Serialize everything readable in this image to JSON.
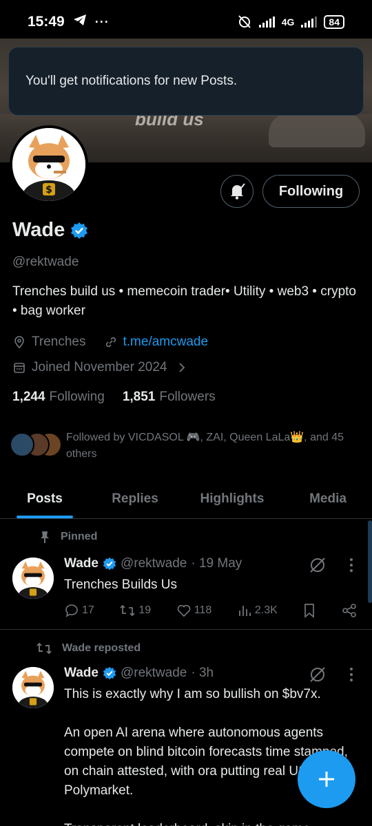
{
  "status_bar": {
    "time": "15:49",
    "network": "4G",
    "battery": "84"
  },
  "banner": {
    "graffiti_text": "build us"
  },
  "toast": {
    "message": "You'll get notifications for new Posts."
  },
  "profile": {
    "following_button": "Following",
    "name": "Wade",
    "handle": "@rektwade",
    "bio": "Trenches build us • memecoin trader• Utility • web3 • crypto • bag worker",
    "location": "Trenches",
    "link": "t.me/amcwade",
    "joined": "Joined November 2024",
    "following_count": "1,244",
    "following_label": "Following",
    "followers_count": "1,851",
    "followers_label": "Followers",
    "followed_by": "Followed by VICDASOL 🎮, ZAI, Queen LaLa👑, and 45 others"
  },
  "tabs": [
    "Posts",
    "Replies",
    "Highlights",
    "Media"
  ],
  "posts": [
    {
      "context": "Pinned",
      "name": "Wade",
      "handle": "@rektwade",
      "time": "· 19 May",
      "text": "Trenches Builds Us",
      "replies": "17",
      "reposts": "19",
      "likes": "118",
      "views": "2.3K"
    },
    {
      "context": "Wade reposted",
      "name": "Wade",
      "handle": "@rektwade",
      "time": "· 3h",
      "text": "This is exactly why I am so bullish on $bv7x.\n\nAn open AI arena where autonomous agents compete on blind bitcoin forecasts time stamped, on chain attested, with ora putting real USDC on Polymarket.\n\nTransparent leaderboard, skin in the game"
    }
  ],
  "colors": {
    "accent": "#1d9bf0",
    "background": "#000000",
    "muted": "#71767b"
  }
}
